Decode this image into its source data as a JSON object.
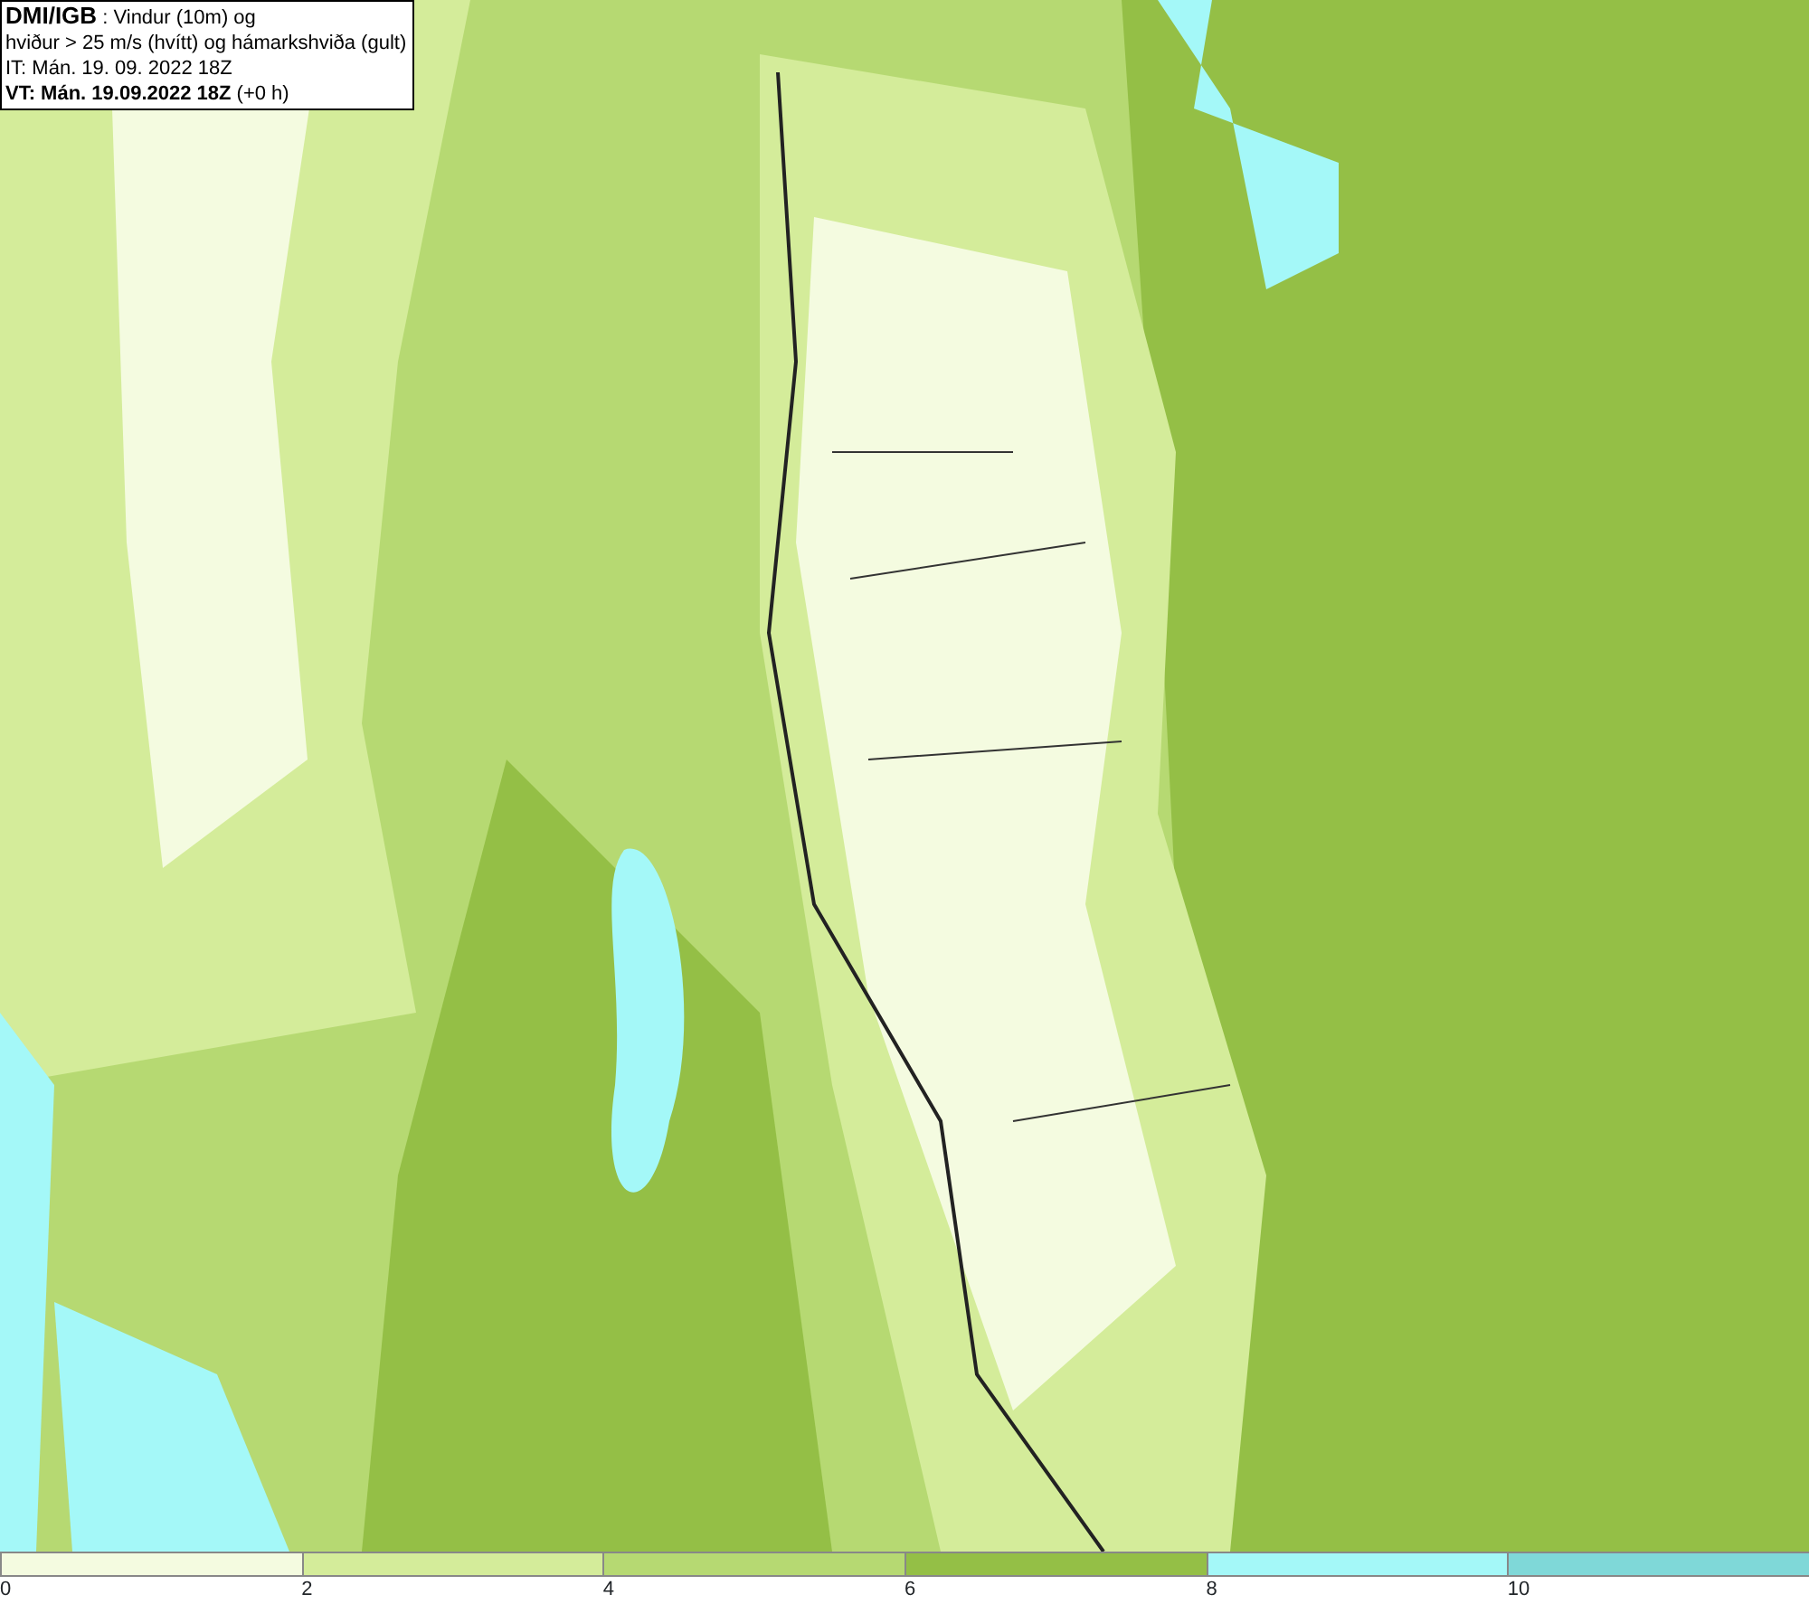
{
  "title_box": {
    "lines": [
      "**DMI/IGB** : Vindur (10m) og",
      "hviður > 25 m/s (hvítt) og hámarkshviða (gult)",
      "IT: Mán. 19. 09. 2022 18Z",
      "**VT: Mán. 19.09.2022 18Z** (+0 h)"
    ]
  },
  "legend": {
    "segments": [
      {
        "label": "0",
        "color": "#f4fbe0"
      },
      {
        "label": "2",
        "color": "#d4ec9a"
      },
      {
        "label": "4",
        "color": "#b6d972"
      },
      {
        "label": "6",
        "color": "#94bf46"
      },
      {
        "label": "8",
        "color": "#a4f8f8"
      },
      {
        "label": "10",
        "color": "#7fd8d8"
      }
    ]
  }
}
